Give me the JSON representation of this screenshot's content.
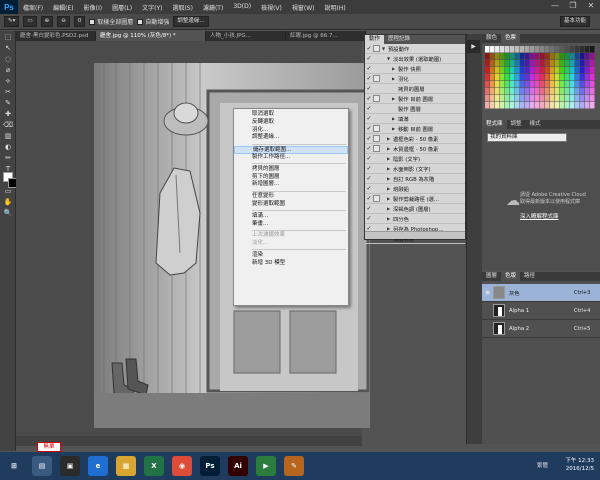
{
  "app": {
    "logo": "Ps"
  },
  "menubar": {
    "items": [
      "檔案(F)",
      "編輯(E)",
      "影像(I)",
      "圖層(L)",
      "文字(Y)",
      "選取(S)",
      "濾鏡(T)",
      "3D(D)",
      "檢視(V)",
      "視窗(W)",
      "說明(H)"
    ],
    "win_controls": [
      "—",
      "❐",
      "✕"
    ]
  },
  "options": {
    "feather_value": "0",
    "sample_all_label": "取樣全部圖層",
    "auto_enhance_label": "自動增強",
    "refine_edge_label": "調整邊緣...",
    "workspace_label": "基本功能"
  },
  "tabs": [
    {
      "label": "廳舍-黑白變彩色.PSD2.psd",
      "active": false
    },
    {
      "label": "廳舍.jpg @ 110% (灰色/8*) *",
      "active": true
    },
    {
      "label": "人物_小孩.JPG...",
      "active": false
    },
    {
      "label": "紅眼.jpg @ 66.7...",
      "active": false
    }
  ],
  "tools": [
    "⬚",
    "↖",
    "◌",
    "⌀",
    "⟡",
    "✂",
    "✎",
    "✚",
    "⌫",
    "▥",
    "◐",
    "✏",
    "T",
    "↗",
    "▭",
    "✋",
    "🔍"
  ],
  "status": {
    "zoom": "無單"
  },
  "context_menu": {
    "items": [
      {
        "label": "取消選取",
        "disabled": false,
        "sep_after": false
      },
      {
        "label": "反轉選取",
        "disabled": false,
        "sep_after": false
      },
      {
        "label": "羽化...",
        "disabled": false,
        "sep_after": false
      },
      {
        "label": "調整邊緣...",
        "disabled": false,
        "sep_after": true
      },
      {
        "label": "儲存選取範圍...",
        "disabled": false,
        "sep_after": false,
        "highlight": true
      },
      {
        "label": "製作工作路徑...",
        "disabled": false,
        "sep_after": true
      },
      {
        "label": "拷貝的圖層",
        "disabled": false,
        "sep_after": false
      },
      {
        "label": "剪下的圖層",
        "disabled": false,
        "sep_after": false
      },
      {
        "label": "新增圖層...",
        "disabled": false,
        "sep_after": true
      },
      {
        "label": "任意變形",
        "disabled": false,
        "sep_after": false
      },
      {
        "label": "變形選取範圍",
        "disabled": false,
        "sep_after": true
      },
      {
        "label": "填滿...",
        "disabled": false,
        "sep_after": false
      },
      {
        "label": "筆畫...",
        "disabled": false,
        "sep_after": true
      },
      {
        "label": "上次濾鏡效果",
        "disabled": true,
        "sep_after": false
      },
      {
        "label": "淡化...",
        "disabled": true,
        "sep_after": true
      },
      {
        "label": "渲染",
        "disabled": false,
        "sep_after": false
      },
      {
        "label": "新增 3D 模型",
        "disabled": false,
        "sep_after": false
      }
    ]
  },
  "actions_panel": {
    "tabs": [
      "動作",
      "歷程記錄"
    ],
    "rows": [
      {
        "label": "預設動作",
        "indent": 0,
        "tri": "▼",
        "checked": true,
        "box": true
      },
      {
        "label": "淡出效果 (選取範圍)",
        "indent": 1,
        "tri": "▼",
        "checked": true,
        "box": false
      },
      {
        "label": "製作 快照",
        "indent": 2,
        "tri": "▶",
        "checked": true,
        "box": false
      },
      {
        "label": "羽化",
        "indent": 2,
        "tri": "▶",
        "checked": true,
        "box": true
      },
      {
        "label": "拷貝的圖層",
        "indent": 2,
        "tri": "",
        "checked": true,
        "box": false
      },
      {
        "label": "製作 目前 圖層",
        "indent": 2,
        "tri": "▶",
        "checked": true,
        "box": true
      },
      {
        "label": "製作 圖層",
        "indent": 2,
        "tri": "",
        "checked": true,
        "box": false
      },
      {
        "label": "填滿",
        "indent": 2,
        "tri": "▶",
        "checked": true,
        "box": false
      },
      {
        "label": "移動 目前 圖層",
        "indent": 2,
        "tri": "▶",
        "checked": true,
        "box": true
      },
      {
        "label": "邊框色彩 - 50 像素",
        "indent": 1,
        "tri": "▶",
        "checked": true,
        "box": true
      },
      {
        "label": "木質邊框 - 50 像素",
        "indent": 1,
        "tri": "▶",
        "checked": true,
        "box": true
      },
      {
        "label": "陰影 (文字)",
        "indent": 1,
        "tri": "▶",
        "checked": true,
        "box": false
      },
      {
        "label": "水面倒影 (文字)",
        "indent": 1,
        "tri": "▶",
        "checked": true,
        "box": false
      },
      {
        "label": "自訂 RGB 為灰階",
        "indent": 1,
        "tri": "▶",
        "checked": true,
        "box": false
      },
      {
        "label": "熔融鉛",
        "indent": 1,
        "tri": "▶",
        "checked": true,
        "box": false
      },
      {
        "label": "製作剪裁路徑 (選...",
        "indent": 1,
        "tri": "▶",
        "checked": true,
        "box": true
      },
      {
        "label": "深褐色調 (圖層)",
        "indent": 1,
        "tri": "▶",
        "checked": true,
        "box": false
      },
      {
        "label": "四分色",
        "indent": 1,
        "tri": "▶",
        "checked": true,
        "box": false
      },
      {
        "label": "另存為 Photoshop...",
        "indent": 1,
        "tri": "▶",
        "checked": true,
        "box": false
      },
      {
        "label": "漸層對應",
        "indent": 1,
        "tri": "▶",
        "checked": true,
        "box": false
      }
    ]
  },
  "color_panel": {
    "tabs": [
      "顏色",
      "色票"
    ]
  },
  "adjust_panel": {
    "tabs": [
      "程式庫",
      "調整",
      "樣式"
    ],
    "library_select": "我的資料庫",
    "cc_message": "請從 Adobe Creative Cloud 取得最新版本以使用程式庫",
    "cc_link": "深入瞭解程式庫"
  },
  "channels_panel": {
    "tabs": [
      "圖層",
      "色版",
      "路徑"
    ],
    "rows": [
      {
        "name": "灰色",
        "key": "Ctrl+3",
        "selected": true,
        "visible": true
      },
      {
        "name": "Alpha 1",
        "key": "Ctrl+4",
        "selected": false,
        "visible": false
      },
      {
        "name": "Alpha 2",
        "key": "Ctrl+5",
        "selected": false,
        "visible": false
      }
    ]
  },
  "taskbar": {
    "icons": [
      {
        "name": "windows",
        "label": "⊞",
        "color": "#1f3b5e"
      },
      {
        "name": "explorer",
        "label": "▤",
        "color": "#3a5a80"
      },
      {
        "name": "cmd",
        "label": "▣",
        "color": "#2b2b2b"
      },
      {
        "name": "ie",
        "label": "e",
        "color": "#1e6fd1"
      },
      {
        "name": "files",
        "label": "▦",
        "color": "#d8a531"
      },
      {
        "name": "excel",
        "label": "X",
        "color": "#217346"
      },
      {
        "name": "chrome",
        "label": "◉",
        "color": "#dd4b39"
      },
      {
        "name": "photoshop",
        "label": "Ps",
        "color": "#001e36"
      },
      {
        "name": "illustrator",
        "label": "Ai",
        "color": "#330000"
      },
      {
        "name": "mediaplayer",
        "label": "▶",
        "color": "#2c7c3e"
      },
      {
        "name": "paint",
        "label": "✎",
        "color": "#b5651d"
      }
    ],
    "tray_label": "繁體",
    "time": "下午 12:33",
    "date": "2016/12/5"
  },
  "colors": {
    "ps_blue": "#31a8ff",
    "selected_channel": "#9ab3d6",
    "taskbar": "#1f3b5e"
  }
}
